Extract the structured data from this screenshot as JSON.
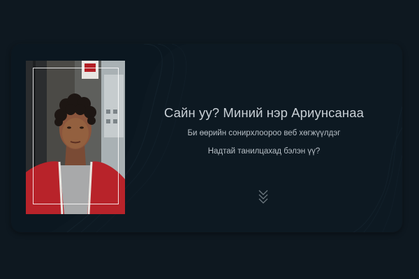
{
  "hero": {
    "greeting": "Сайн уу? Миний нэр Ариунсанаа",
    "line1": "Би өөрийн сонирхлоороо веб хөгжүүлдэг",
    "line2": "Надтай танилцахад бэлэн үү?"
  },
  "icons": {
    "scroll_down": "chevron-double-down-icon"
  },
  "colors": {
    "background": "#0e1820",
    "card": "#0d1922",
    "text": "#c9d0d6",
    "jacket": "#b8232a"
  }
}
